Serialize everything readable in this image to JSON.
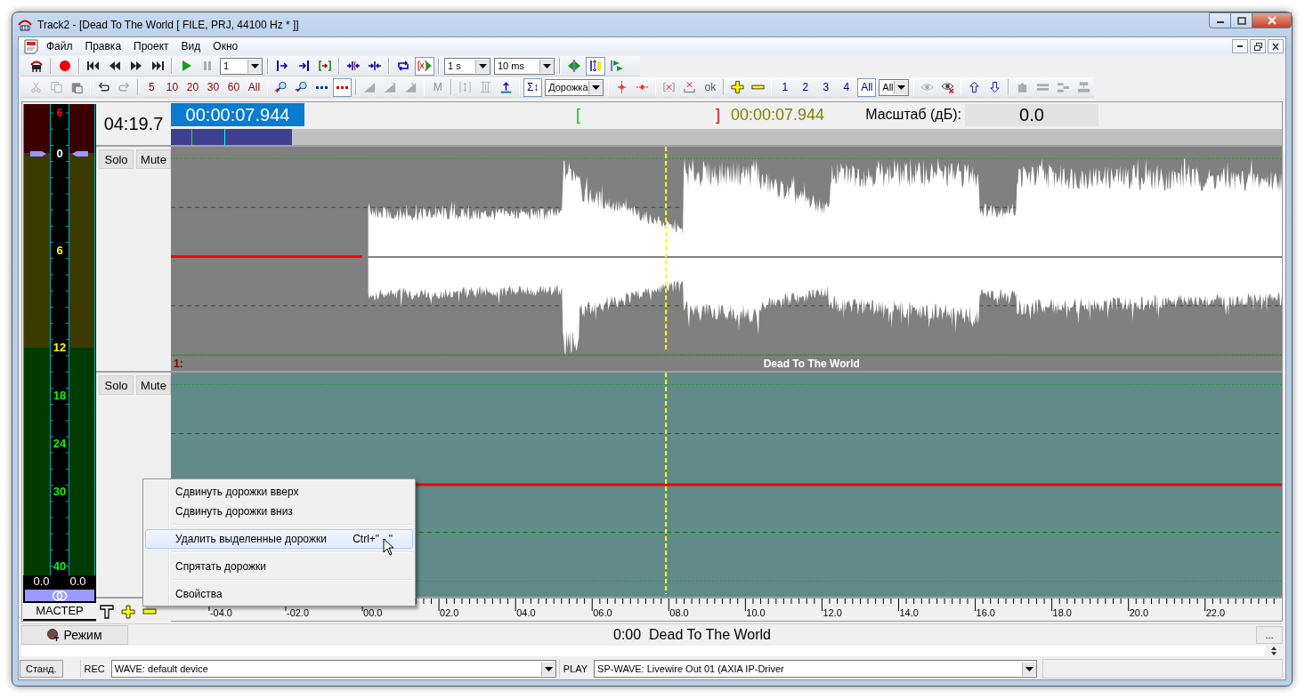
{
  "window": {
    "title": "Track2 - [Dead To The World [ FILE, PRJ, 44100 Hz * ]]"
  },
  "menu": [
    "Файл",
    "Правка",
    "Проект",
    "Вид",
    "Окно"
  ],
  "toolbar_1": [
    {
      "kind": "icon",
      "pressed": false,
      "disabled": false
    },
    {
      "kind": "sep"
    },
    {
      "kind": "icon",
      "pressed": false,
      "disabled": false
    },
    {
      "kind": "sep"
    },
    {
      "kind": "icon",
      "pressed": false,
      "disabled": false
    },
    {
      "kind": "icon",
      "pressed": false,
      "disabled": false
    },
    {
      "kind": "icon",
      "pressed": false,
      "disabled": false
    },
    {
      "kind": "icon",
      "pressed": false,
      "disabled": false
    },
    {
      "kind": "sep"
    },
    {
      "kind": "icon",
      "pressed": false,
      "disabled": false
    },
    {
      "kind": "icon",
      "pressed": false,
      "disabled": true
    },
    {
      "kind": "select",
      "value": "1"
    },
    {
      "kind": "sep"
    },
    {
      "kind": "icon",
      "pressed": false,
      "disabled": false
    },
    {
      "kind": "icon",
      "pressed": false,
      "disabled": false
    },
    {
      "kind": "icon",
      "pressed": false,
      "disabled": false
    },
    {
      "kind": "sep"
    },
    {
      "kind": "icon",
      "pressed": false,
      "disabled": false
    },
    {
      "kind": "icon",
      "pressed": false,
      "disabled": false
    },
    {
      "kind": "sep"
    },
    {
      "kind": "icon",
      "pressed": false,
      "disabled": false
    },
    {
      "kind": "icon",
      "pressed": true,
      "disabled": false
    },
    {
      "kind": "sep"
    },
    {
      "kind": "select",
      "value": "1 s"
    },
    {
      "kind": "select",
      "value": "10 ms"
    },
    {
      "kind": "sep"
    },
    {
      "kind": "icon",
      "pressed": false,
      "disabled": false
    },
    {
      "kind": "icon",
      "pressed": true,
      "disabled": false
    },
    {
      "kind": "icon",
      "pressed": false,
      "disabled": false
    }
  ],
  "toolbar_2": [
    {
      "kind": "icon",
      "pressed": false,
      "disabled": true
    },
    {
      "kind": "icon",
      "pressed": false,
      "disabled": true
    },
    {
      "kind": "icon",
      "pressed": false,
      "disabled": false
    },
    {
      "kind": "sep"
    },
    {
      "kind": "icon",
      "pressed": false,
      "disabled": false
    },
    {
      "kind": "icon",
      "pressed": false,
      "disabled": true
    },
    {
      "kind": "sep"
    },
    {
      "kind": "zoomstep",
      "text": "5",
      "pressed": false,
      "disabled": false
    },
    {
      "kind": "zoomstep",
      "text": "10",
      "pressed": false,
      "disabled": false
    },
    {
      "kind": "zoomstep",
      "text": "20",
      "pressed": false,
      "disabled": false
    },
    {
      "kind": "zoomstep",
      "text": "30",
      "pressed": false,
      "disabled": false
    },
    {
      "kind": "zoomstep",
      "text": "60",
      "pressed": false,
      "disabled": false
    },
    {
      "kind": "zoomstep",
      "text": "All",
      "pressed": false,
      "disabled": false
    },
    {
      "kind": "sep"
    },
    {
      "kind": "icon",
      "pressed": false,
      "disabled": false
    },
    {
      "kind": "icon",
      "pressed": false,
      "disabled": false
    },
    {
      "kind": "icon",
      "pressed": false,
      "disabled": false
    },
    {
      "kind": "icon",
      "pressed": true,
      "disabled": false
    },
    {
      "kind": "sep"
    },
    {
      "kind": "icon",
      "pressed": false,
      "disabled": true
    },
    {
      "kind": "icon",
      "pressed": false,
      "disabled": true
    },
    {
      "kind": "icon",
      "pressed": false,
      "disabled": true
    },
    {
      "kind": "sep"
    },
    {
      "kind": "plain",
      "text": "M",
      "pressed": false,
      "disabled": true
    },
    {
      "kind": "sep"
    },
    {
      "kind": "icon",
      "pressed": false,
      "disabled": true
    },
    {
      "kind": "icon",
      "pressed": false,
      "disabled": true
    },
    {
      "kind": "icon",
      "pressed": false,
      "disabled": false
    },
    {
      "kind": "sep"
    },
    {
      "kind": "trackno",
      "text": "Σ↕",
      "pressed": true,
      "disabled": false
    },
    {
      "kind": "select",
      "value": "Дорожка"
    },
    {
      "kind": "sep"
    },
    {
      "kind": "icon",
      "pressed": false,
      "disabled": false
    },
    {
      "kind": "icon",
      "pressed": false,
      "disabled": false
    },
    {
      "kind": "sep"
    },
    {
      "kind": "icon",
      "pressed": false,
      "disabled": false
    },
    {
      "kind": "icon",
      "pressed": false,
      "disabled": false
    },
    {
      "kind": "plain",
      "text": "ok",
      "pressed": false,
      "disabled": false
    },
    {
      "kind": "sep"
    },
    {
      "kind": "icon",
      "pressed": false,
      "disabled": false
    },
    {
      "kind": "icon",
      "pressed": false,
      "disabled": false
    },
    {
      "kind": "sep"
    },
    {
      "kind": "trackno",
      "text": "1",
      "pressed": false,
      "disabled": false
    },
    {
      "kind": "trackno",
      "text": "2",
      "pressed": false,
      "disabled": false
    },
    {
      "kind": "trackno",
      "text": "3",
      "pressed": false,
      "disabled": false
    },
    {
      "kind": "trackno",
      "text": "4",
      "pressed": false,
      "disabled": false
    },
    {
      "kind": "trackno",
      "text": "All",
      "pressed": true,
      "disabled": false
    },
    {
      "kind": "select",
      "value": "All"
    },
    {
      "kind": "sep"
    },
    {
      "kind": "icon",
      "pressed": false,
      "disabled": true
    },
    {
      "kind": "icon",
      "pressed": false,
      "disabled": false
    },
    {
      "kind": "sep"
    },
    {
      "kind": "icon",
      "pressed": false,
      "disabled": false
    },
    {
      "kind": "icon",
      "pressed": false,
      "disabled": false
    },
    {
      "kind": "sep"
    },
    {
      "kind": "icon",
      "pressed": false,
      "disabled": true
    },
    {
      "kind": "icon",
      "pressed": false,
      "disabled": true
    },
    {
      "kind": "icon",
      "pressed": false,
      "disabled": true
    },
    {
      "kind": "icon",
      "pressed": false,
      "disabled": true
    }
  ],
  "meter": {
    "scale": [
      {
        "label": "6",
        "color": "#ff0000"
      },
      {
        "label": "0",
        "color": "#ffffff"
      },
      {
        "label": "6",
        "color": "#ffff00"
      },
      {
        "label": "12",
        "color": "#ffff00"
      },
      {
        "label": "18",
        "color": "#00ff00"
      },
      {
        "label": "24",
        "color": "#00ff00"
      },
      {
        "label": "30",
        "color": "#00ff00"
      },
      {
        "label": "40",
        "color": "#00ff00"
      }
    ],
    "readings": [
      "0.0",
      "0.0"
    ],
    "name": "МАСТЕР"
  },
  "header": {
    "duration": "04:19.7",
    "position": "00:00:07.944",
    "selection_start": "[",
    "selection_end": "]",
    "selection_length": "00:00:07.944",
    "scale_label": "Масштаб (дБ):",
    "scale_value": "0.0"
  },
  "tracks": [
    {
      "number": "1:",
      "title": "Dead To The World",
      "buttons": [
        "Solo",
        "Mute"
      ],
      "selected": false,
      "has_audio": true
    },
    {
      "buttons": [
        "Solo",
        "Mute"
      ],
      "selected": true,
      "has_audio": false
    }
  ],
  "ruler": [
    "-04.0",
    "-02.0",
    "00.0",
    "02.0",
    "04.0",
    "06.0",
    "08.0",
    "10.0",
    "12.0",
    "14.0",
    "16.0",
    "18.0",
    "20.0",
    "22.0"
  ],
  "context_menu": [
    {
      "kind": "item",
      "label": "Сдвинуть дорожки вверх",
      "selected": false
    },
    {
      "kind": "item",
      "label": "Сдвинуть дорожки вниз",
      "selected": false
    },
    {
      "kind": "sep"
    },
    {
      "kind": "item",
      "label": "Удалить выделенные дорожки",
      "shortcut": "Ctrl+\" - \"",
      "selected": true
    },
    {
      "kind": "sep"
    },
    {
      "kind": "item",
      "label": "Спрятать дорожки",
      "selected": false
    },
    {
      "kind": "sep"
    },
    {
      "kind": "item",
      "label": "Свойства",
      "selected": false
    }
  ],
  "transport": {
    "mode_button": "Режим",
    "now_playing": "0:00  Dead To The World",
    "more_button": "..."
  },
  "status_bar": {
    "preset_button": "Станд.",
    "rec_label": "REC",
    "rec_device": "WAVE: default device",
    "play_label": "PLAY",
    "play_device": "SP-WAVE: Livewire Out 01 (AXIA IP-Driver"
  }
}
